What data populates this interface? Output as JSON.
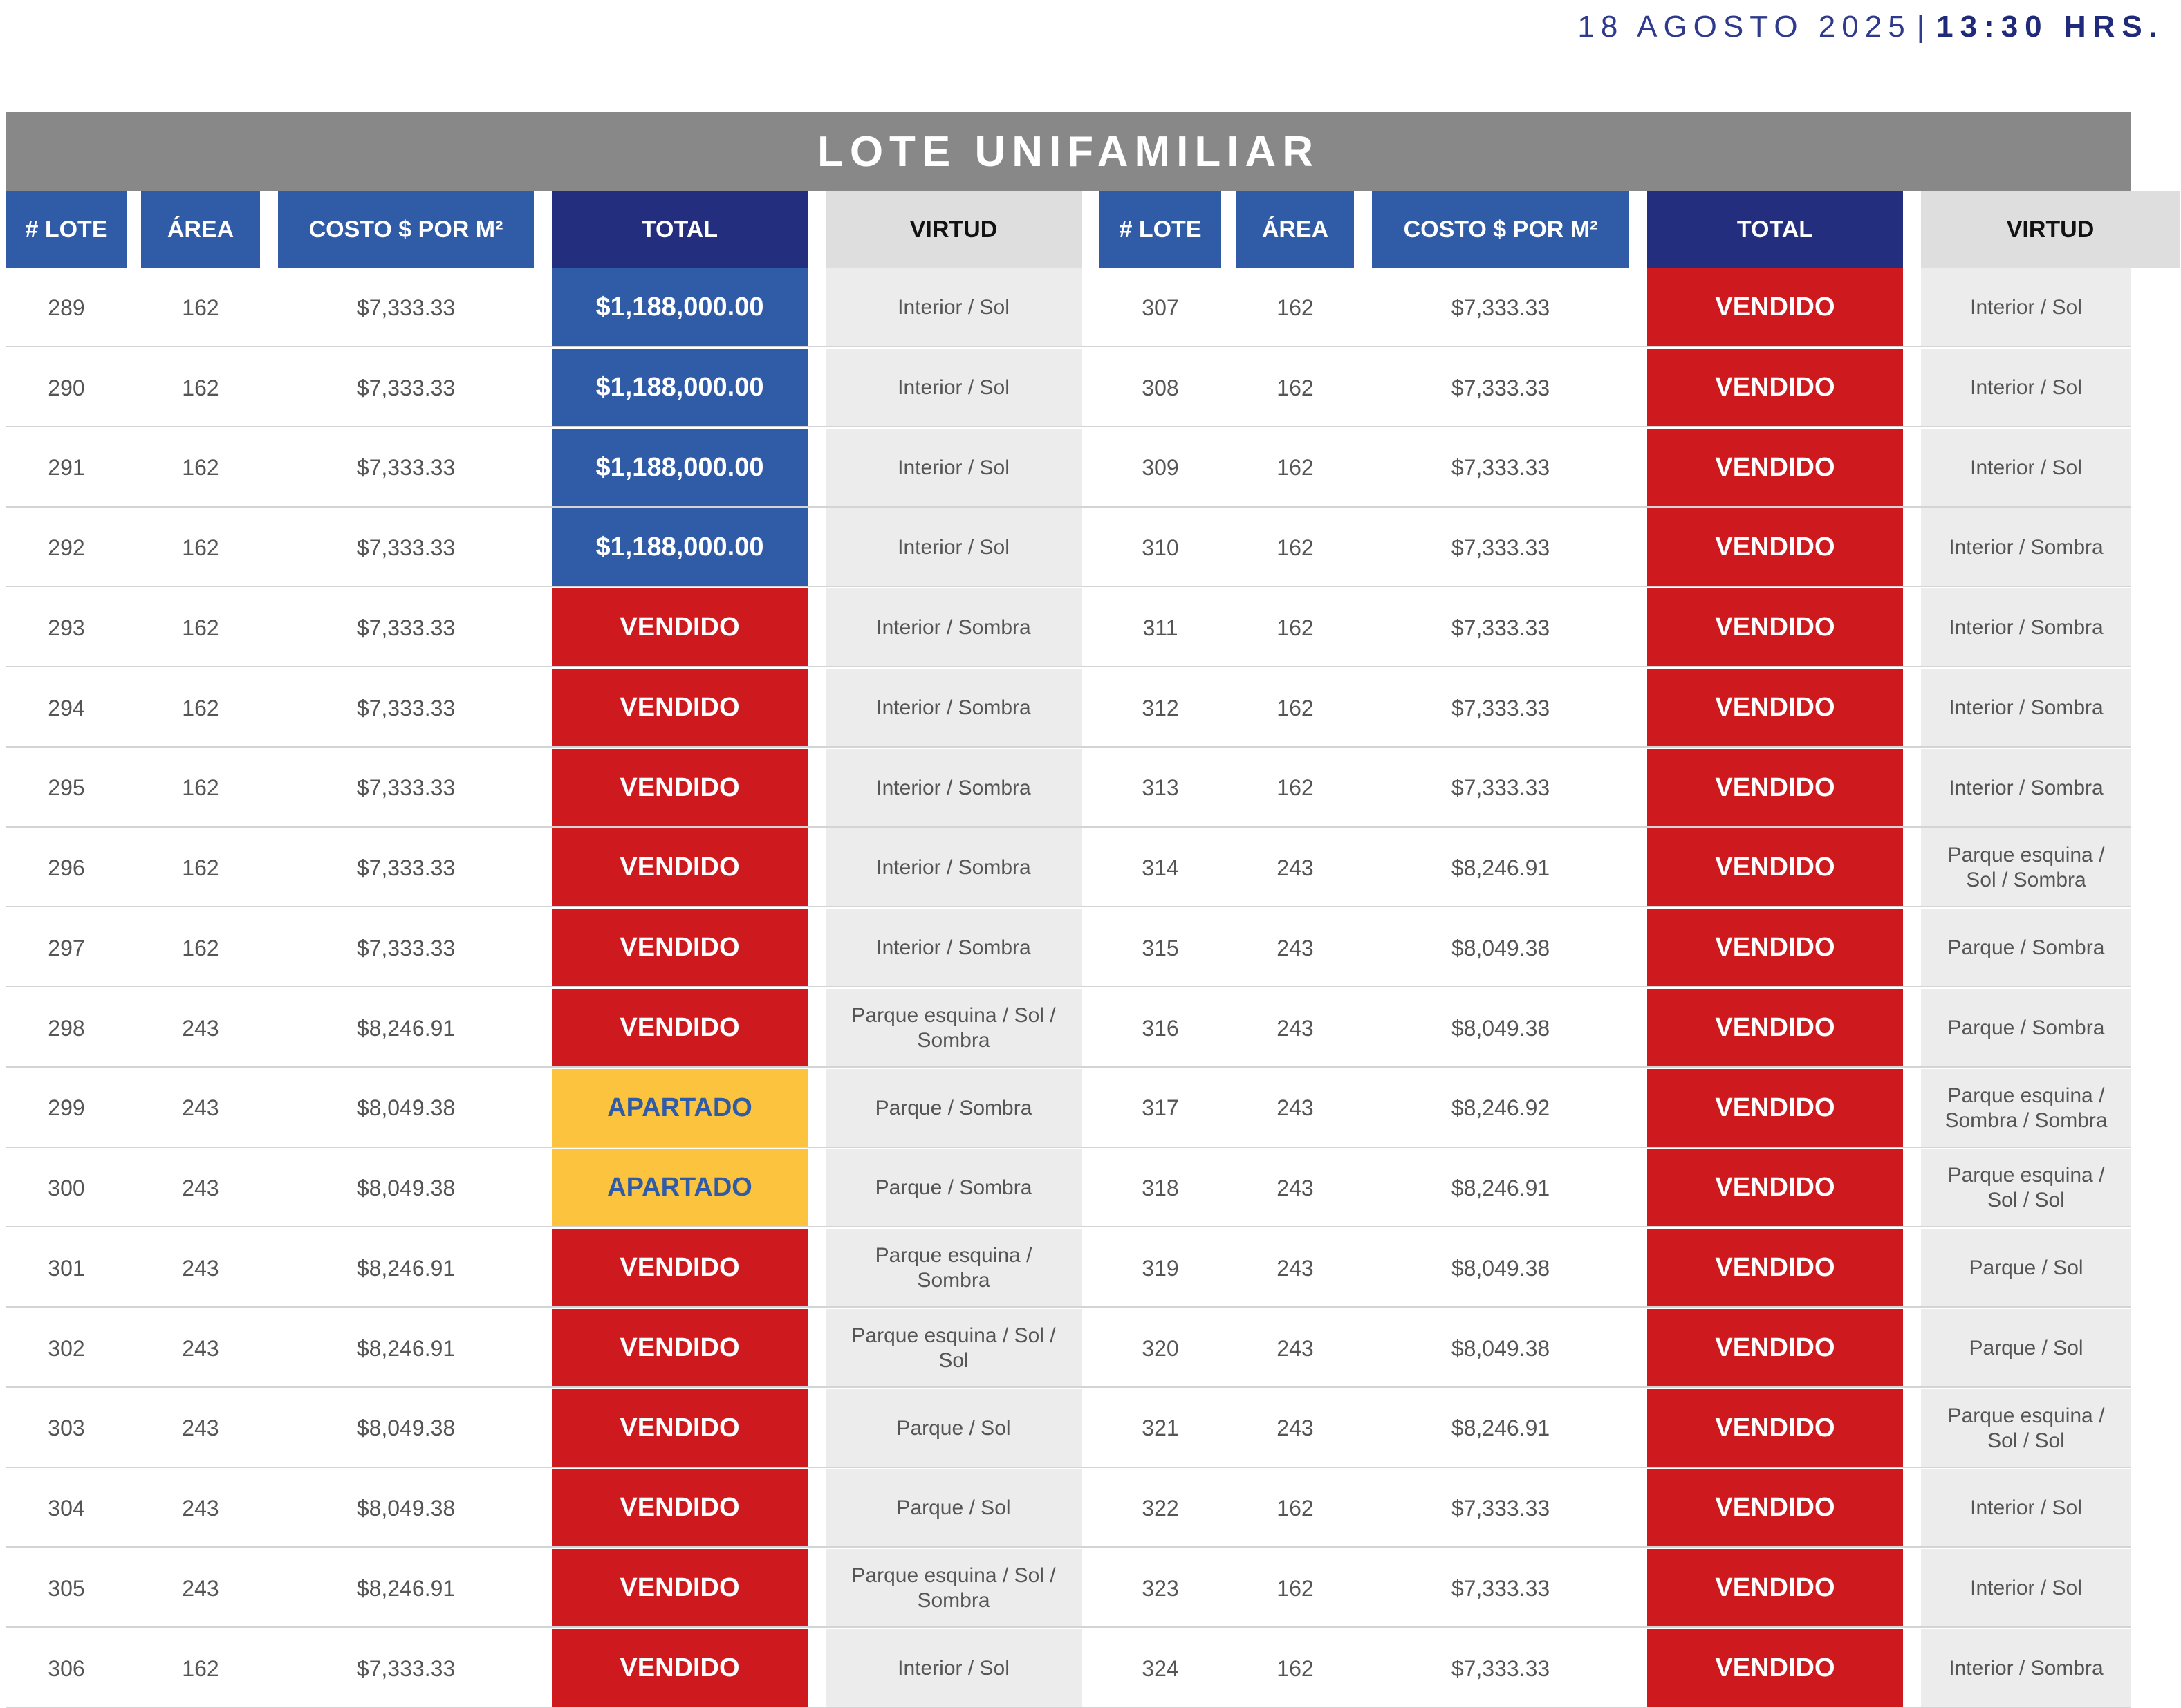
{
  "header": {
    "date": "18 AGOSTO 2025",
    "separator": "|",
    "time": "13:30 HRS."
  },
  "table": {
    "title": "LOTE UNIFAMILIAR",
    "columns": [
      "# LOTE",
      "ÁREA",
      "COSTO $ POR M²",
      "TOTAL",
      "VIRTUD"
    ],
    "status_colors": {
      "price": "#2f5ba7",
      "sold": "#ce1a1e",
      "reserved": "#fcc33e"
    },
    "left": [
      {
        "lote": "289",
        "area": "162",
        "costo": "$7,333.33",
        "total": "$1,188,000.00",
        "status": "price",
        "virtud": "Interior / Sol"
      },
      {
        "lote": "290",
        "area": "162",
        "costo": "$7,333.33",
        "total": "$1,188,000.00",
        "status": "price",
        "virtud": "Interior / Sol"
      },
      {
        "lote": "291",
        "area": "162",
        "costo": "$7,333.33",
        "total": "$1,188,000.00",
        "status": "price",
        "virtud": "Interior / Sol"
      },
      {
        "lote": "292",
        "area": "162",
        "costo": "$7,333.33",
        "total": "$1,188,000.00",
        "status": "price",
        "virtud": "Interior / Sol"
      },
      {
        "lote": "293",
        "area": "162",
        "costo": "$7,333.33",
        "total": "VENDIDO",
        "status": "sold",
        "virtud": "Interior / Sombra"
      },
      {
        "lote": "294",
        "area": "162",
        "costo": "$7,333.33",
        "total": "VENDIDO",
        "status": "sold",
        "virtud": "Interior / Sombra"
      },
      {
        "lote": "295",
        "area": "162",
        "costo": "$7,333.33",
        "total": "VENDIDO",
        "status": "sold",
        "virtud": "Interior / Sombra"
      },
      {
        "lote": "296",
        "area": "162",
        "costo": "$7,333.33",
        "total": "VENDIDO",
        "status": "sold",
        "virtud": "Interior / Sombra"
      },
      {
        "lote": "297",
        "area": "162",
        "costo": "$7,333.33",
        "total": "VENDIDO",
        "status": "sold",
        "virtud": "Interior / Sombra"
      },
      {
        "lote": "298",
        "area": "243",
        "costo": "$8,246.91",
        "total": "VENDIDO",
        "status": "sold",
        "virtud": "Parque esquina / Sol / Sombra"
      },
      {
        "lote": "299",
        "area": "243",
        "costo": "$8,049.38",
        "total": "APARTADO",
        "status": "reserved",
        "virtud": "Parque / Sombra"
      },
      {
        "lote": "300",
        "area": "243",
        "costo": "$8,049.38",
        "total": "APARTADO",
        "status": "reserved",
        "virtud": "Parque / Sombra"
      },
      {
        "lote": "301",
        "area": "243",
        "costo": "$8,246.91",
        "total": "VENDIDO",
        "status": "sold",
        "virtud": "Parque esquina / Sombra"
      },
      {
        "lote": "302",
        "area": "243",
        "costo": "$8,246.91",
        "total": "VENDIDO",
        "status": "sold",
        "virtud": "Parque esquina / Sol / Sol"
      },
      {
        "lote": "303",
        "area": "243",
        "costo": "$8,049.38",
        "total": "VENDIDO",
        "status": "sold",
        "virtud": "Parque / Sol"
      },
      {
        "lote": "304",
        "area": "243",
        "costo": "$8,049.38",
        "total": "VENDIDO",
        "status": "sold",
        "virtud": "Parque / Sol"
      },
      {
        "lote": "305",
        "area": "243",
        "costo": "$8,246.91",
        "total": "VENDIDO",
        "status": "sold",
        "virtud": "Parque esquina / Sol / Sombra"
      },
      {
        "lote": "306",
        "area": "162",
        "costo": "$7,333.33",
        "total": "VENDIDO",
        "status": "sold",
        "virtud": "Interior / Sol"
      }
    ],
    "right": [
      {
        "lote": "307",
        "area": "162",
        "costo": "$7,333.33",
        "total": "VENDIDO",
        "status": "sold",
        "virtud": "Interior / Sol"
      },
      {
        "lote": "308",
        "area": "162",
        "costo": "$7,333.33",
        "total": "VENDIDO",
        "status": "sold",
        "virtud": "Interior / Sol"
      },
      {
        "lote": "309",
        "area": "162",
        "costo": "$7,333.33",
        "total": "VENDIDO",
        "status": "sold",
        "virtud": "Interior / Sol"
      },
      {
        "lote": "310",
        "area": "162",
        "costo": "$7,333.33",
        "total": "VENDIDO",
        "status": "sold",
        "virtud": "Interior / Sombra"
      },
      {
        "lote": "311",
        "area": "162",
        "costo": "$7,333.33",
        "total": "VENDIDO",
        "status": "sold",
        "virtud": "Interior / Sombra"
      },
      {
        "lote": "312",
        "area": "162",
        "costo": "$7,333.33",
        "total": "VENDIDO",
        "status": "sold",
        "virtud": "Interior / Sombra"
      },
      {
        "lote": "313",
        "area": "162",
        "costo": "$7,333.33",
        "total": "VENDIDO",
        "status": "sold",
        "virtud": "Interior / Sombra"
      },
      {
        "lote": "314",
        "area": "243",
        "costo": "$8,246.91",
        "total": "VENDIDO",
        "status": "sold",
        "virtud": "Parque esquina / Sol / Sombra"
      },
      {
        "lote": "315",
        "area": "243",
        "costo": "$8,049.38",
        "total": "VENDIDO",
        "status": "sold",
        "virtud": "Parque / Sombra"
      },
      {
        "lote": "316",
        "area": "243",
        "costo": "$8,049.38",
        "total": "VENDIDO",
        "status": "sold",
        "virtud": "Parque / Sombra"
      },
      {
        "lote": "317",
        "area": "243",
        "costo": "$8,246.92",
        "total": "VENDIDO",
        "status": "sold",
        "virtud": "Parque esquina / Sombra / Sombra"
      },
      {
        "lote": "318",
        "area": "243",
        "costo": "$8,246.91",
        "total": "VENDIDO",
        "status": "sold",
        "virtud": "Parque esquina / Sol / Sol"
      },
      {
        "lote": "319",
        "area": "243",
        "costo": "$8,049.38",
        "total": "VENDIDO",
        "status": "sold",
        "virtud": "Parque / Sol"
      },
      {
        "lote": "320",
        "area": "243",
        "costo": "$8,049.38",
        "total": "VENDIDO",
        "status": "sold",
        "virtud": "Parque / Sol"
      },
      {
        "lote": "321",
        "area": "243",
        "costo": "$8,246.91",
        "total": "VENDIDO",
        "status": "sold",
        "virtud": "Parque esquina / Sol / Sol"
      },
      {
        "lote": "322",
        "area": "162",
        "costo": "$7,333.33",
        "total": "VENDIDO",
        "status": "sold",
        "virtud": "Interior / Sol"
      },
      {
        "lote": "323",
        "area": "162",
        "costo": "$7,333.33",
        "total": "VENDIDO",
        "status": "sold",
        "virtud": "Interior / Sol"
      },
      {
        "lote": "324",
        "area": "162",
        "costo": "$7,333.33",
        "total": "VENDIDO",
        "status": "sold",
        "virtud": "Interior / Sombra"
      }
    ]
  }
}
